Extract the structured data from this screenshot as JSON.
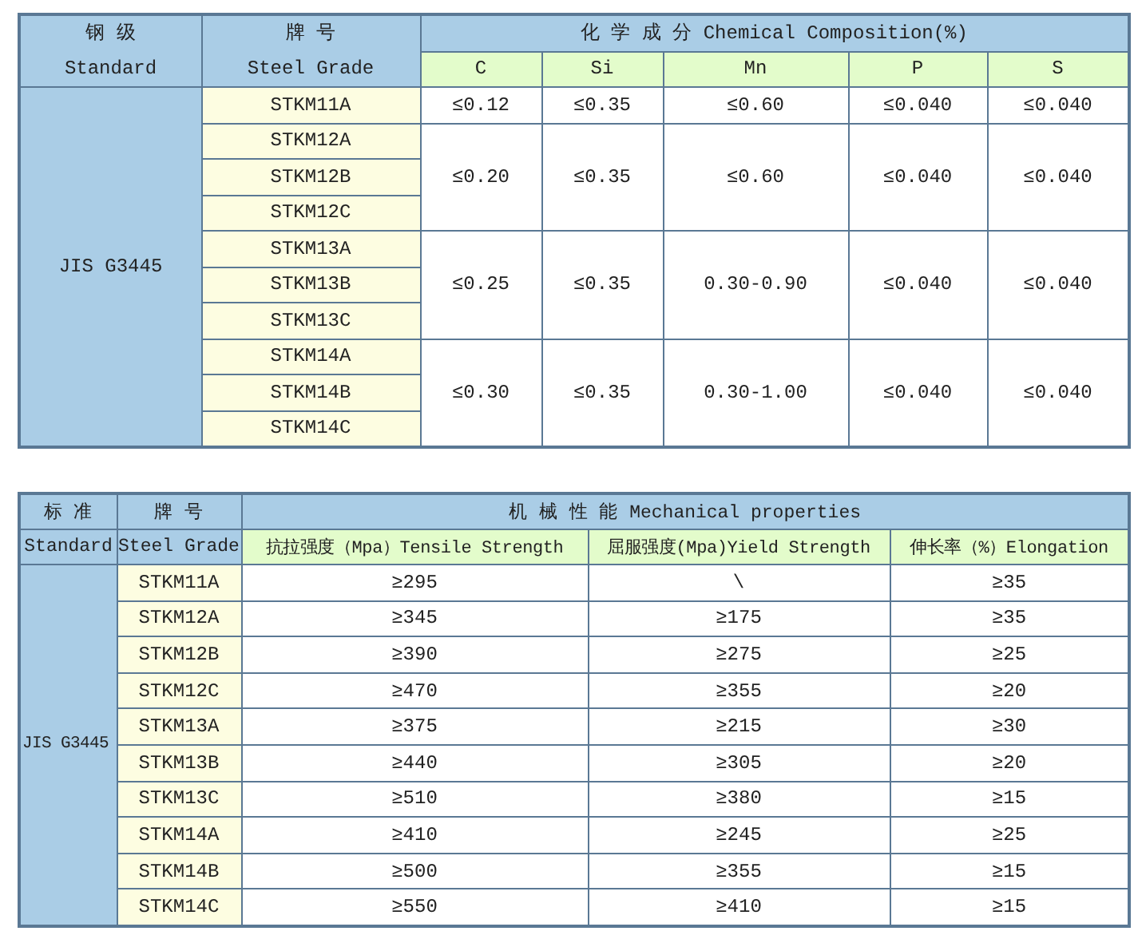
{
  "chemical_table": {
    "standard_heading": [
      "钢 级",
      "Standard"
    ],
    "grade_heading": [
      "牌 号",
      "Steel Grade"
    ],
    "title": "化 学 成 分 Chemical Composition(%)",
    "columns": [
      "C",
      "Si",
      "Mn",
      "P",
      "S"
    ],
    "standard": "JIS G3445",
    "groups": [
      {
        "grades": [
          "STKM11A"
        ],
        "values": [
          "≤0.12",
          "≤0.35",
          "≤0.60",
          "≤0.040",
          "≤0.040"
        ]
      },
      {
        "grades": [
          "STKM12A",
          "STKM12B",
          "STKM12C"
        ],
        "values": [
          "≤0.20",
          "≤0.35",
          "≤0.60",
          "≤0.040",
          "≤0.040"
        ]
      },
      {
        "grades": [
          "STKM13A",
          "STKM13B",
          "STKM13C"
        ],
        "values": [
          "≤0.25",
          "≤0.35",
          "0.30-0.90",
          "≤0.040",
          "≤0.040"
        ]
      },
      {
        "grades": [
          "STKM14A",
          "STKM14B",
          "STKM14C"
        ],
        "values": [
          "≤0.30",
          "≤0.35",
          "0.30-1.00",
          "≤0.040",
          "≤0.040"
        ]
      }
    ]
  },
  "mechanical_table": {
    "standard_heading": [
      "标 准",
      "Standard"
    ],
    "grade_heading": [
      "牌 号",
      "Steel Grade"
    ],
    "title": "机 械 性 能 Mechanical properties",
    "columns": [
      "抗拉强度（Mpa）Tensile Strength",
      "屈服强度(Mpa)Yield Strength",
      "伸长率（%）Elongation"
    ],
    "standard": "JIS G3445",
    "rows": [
      {
        "grade": "STKM11A",
        "values": [
          "≥295",
          "\\",
          "≥35"
        ]
      },
      {
        "grade": "STKM12A",
        "values": [
          "≥345",
          "≥175",
          "≥35"
        ]
      },
      {
        "grade": "STKM12B",
        "values": [
          "≥390",
          "≥275",
          "≥25"
        ]
      },
      {
        "grade": "STKM12C",
        "values": [
          "≥470",
          "≥355",
          "≥20"
        ]
      },
      {
        "grade": "STKM13A",
        "values": [
          "≥375",
          "≥215",
          "≥30"
        ]
      },
      {
        "grade": "STKM13B",
        "values": [
          "≥440",
          "≥305",
          "≥20"
        ]
      },
      {
        "grade": "STKM13C",
        "values": [
          "≥510",
          "≥380",
          "≥15"
        ]
      },
      {
        "grade": "STKM14A",
        "values": [
          "≥410",
          "≥245",
          "≥25"
        ]
      },
      {
        "grade": "STKM14B",
        "values": [
          "≥500",
          "≥355",
          "≥15"
        ]
      },
      {
        "grade": "STKM14C",
        "values": [
          "≥550",
          "≥410",
          "≥15"
        ]
      }
    ]
  }
}
